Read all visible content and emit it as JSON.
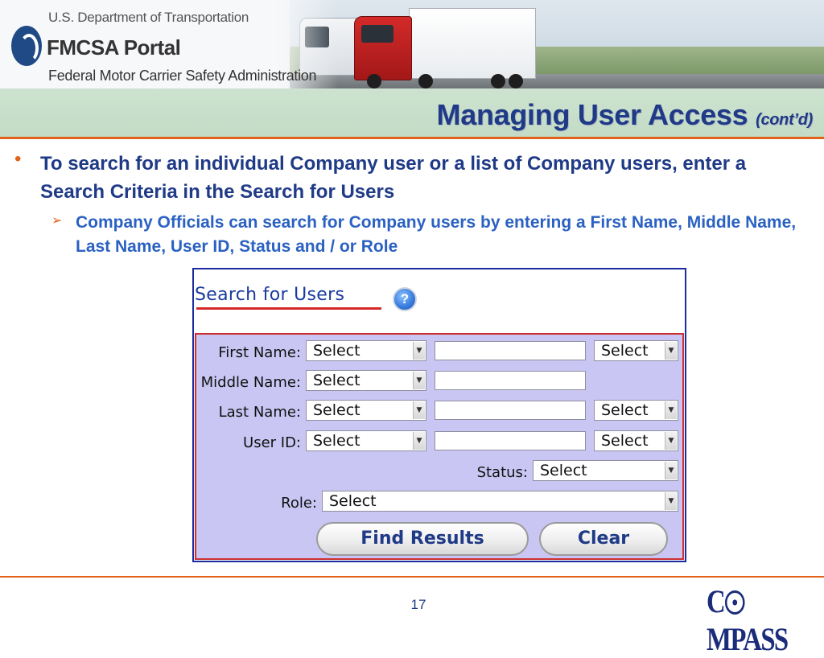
{
  "header": {
    "department": "U.S. Department of Transportation",
    "portal": "FMCSA Portal",
    "agency": "Federal Motor Carrier Safety Administration"
  },
  "slide": {
    "title": "Managing User Access",
    "title_suffix": "(cont’d)",
    "bullet1": "To search for an individual Company user or a list of Company users, enter a Search Criteria in the Search for Users",
    "bullet2": "Company Officials can search for Company users by entering a First Name, Middle Name, Last Name, User ID, Status and / or Role",
    "page_number": "17",
    "footer_logo": "COMPASS"
  },
  "search_panel": {
    "title": "Search for Users",
    "help_icon": "?",
    "fields": {
      "first_name": {
        "label": "First Name:",
        "operator": "Select",
        "value": "",
        "connector": "Select"
      },
      "middle_name": {
        "label": "Middle Name:",
        "operator": "Select",
        "value": ""
      },
      "last_name": {
        "label": "Last Name:",
        "operator": "Select",
        "value": "",
        "connector": "Select"
      },
      "user_id": {
        "label": "User ID:",
        "operator": "Select",
        "value": "",
        "connector": "Select"
      },
      "status": {
        "label": "Status:",
        "value": "Select"
      },
      "role": {
        "label": "Role:",
        "value": "Select"
      }
    },
    "buttons": {
      "find": "Find Results",
      "clear": "Clear"
    }
  },
  "colors": {
    "title_blue": "#1f3a86",
    "accent_orange": "#e2621b",
    "sub_blue": "#2a61c2",
    "panel_bg": "#c9c6f3",
    "panel_border": "#cc3030"
  }
}
